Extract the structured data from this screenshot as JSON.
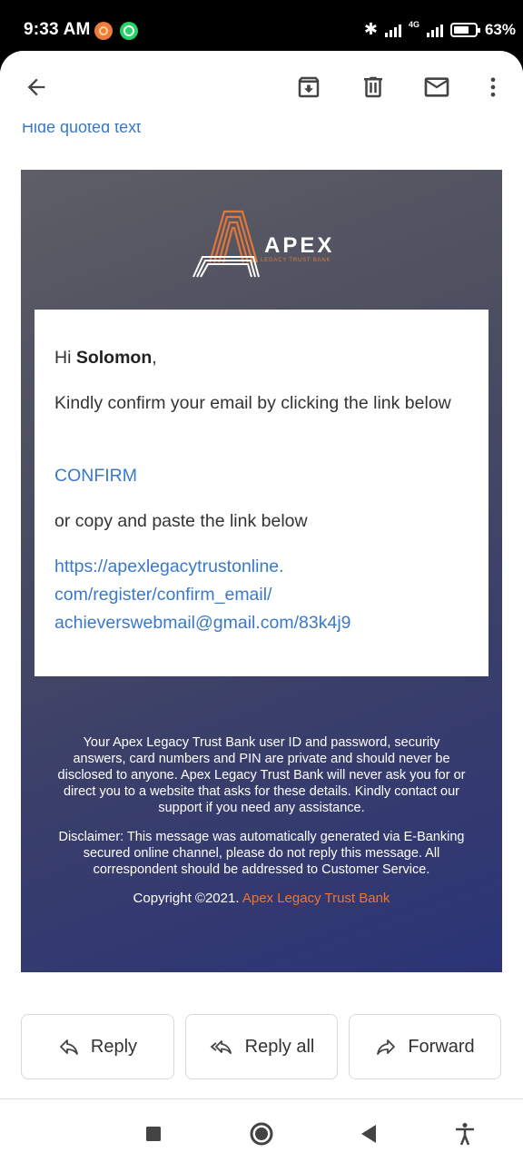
{
  "status_bar": {
    "time": "9:33 AM",
    "battery": "63%",
    "network": "4G"
  },
  "toolbar": {
    "back_icon": "arrow-left-icon",
    "archive_icon": "archive-icon",
    "delete_icon": "trash-icon",
    "mark_unread_icon": "mail-icon",
    "more_icon": "more-vertical-icon"
  },
  "thread": {
    "hide_quoted_text": "Hide quoted text"
  },
  "email": {
    "brand_name": "APEX",
    "brand_subtitle": "LEGACY TRUST BANK",
    "greeting_prefix": "Hi ",
    "recipient_name": "Solomon",
    "greeting_suffix": ",",
    "message": "Kindly confirm your email by clicking the link below",
    "confirm_link": "CONFIRM",
    "copy_text": "or copy and paste the link below",
    "url": "https://apexlegacytrustonline.com/register/confirm_email/achieverswebmail@gmail.com/83k4j9",
    "url_lines": [
      "https://apexlegacytrustonline.",
      "com/register/confirm_email/",
      "achieverswebmail@gmail.com/83k4j9"
    ],
    "footer_notice": "Your Apex Legacy Trust Bank user ID and password, security answers, card numbers and PIN are private and should never be disclosed to anyone. Apex Legacy Trust Bank will never ask you for or direct you to a website that asks for these details. Kindly contact our support if you need any assistance.",
    "disclaimer": "Disclaimer: This message was automatically generated via E-Banking secured online channel, please do not reply this message. All correspondent should be addressed to Customer Service.",
    "copyright_prefix": "Copyright ©2021. ",
    "copyright_brand": "Apex Legacy Trust Bank"
  },
  "actions": {
    "reply": "Reply",
    "reply_all": "Reply all",
    "forward": "Forward"
  },
  "colors": {
    "link_blue": "#3a79c7",
    "brand_orange": "#f07431",
    "email_bg_top": "#5e5e66",
    "email_bg_bottom": "#2b3477"
  }
}
